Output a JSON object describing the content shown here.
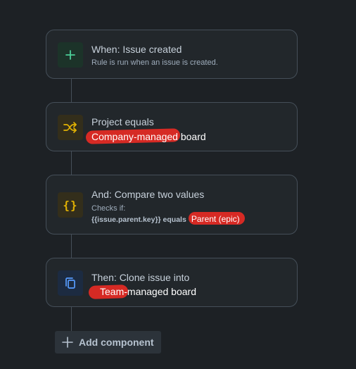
{
  "rule": {
    "trigger": {
      "title": "When: Issue created",
      "subtitle": "Rule is run when an issue is created.",
      "icon": "plus-icon",
      "color": "#4bce97"
    },
    "condition1": {
      "title": "Project equals",
      "value_redacted": "Company-managed",
      "value_rest": " board",
      "icon": "shuffle-icon",
      "color": "#e2b203"
    },
    "condition2": {
      "title": "And: Compare two values",
      "checks_label": "Checks if:",
      "expression": "{{issue.parent.key}} equals",
      "value_a": "Parent (ep",
      "value_b": "ic)",
      "icon": "braces-icon",
      "color": "#e2b203"
    },
    "action": {
      "title": "Then: Clone issue into",
      "value_redacted": "Team-",
      "value_rest": "managed board",
      "icon": "copy-icon",
      "color": "#579dff"
    }
  },
  "add_component": {
    "label": "Add component",
    "icon": "plus-icon"
  },
  "colors": {
    "background": "#1d2125",
    "card": "#22272b",
    "border": "#454f59",
    "redaction": "#d62a24"
  }
}
